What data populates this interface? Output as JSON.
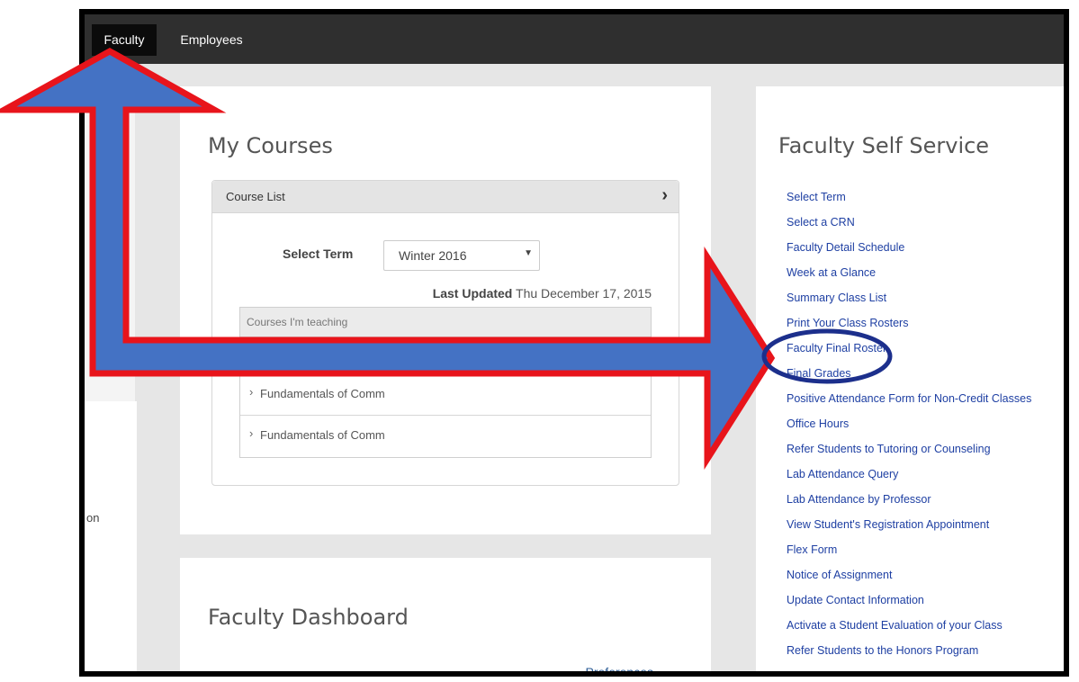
{
  "topnav": {
    "tabs": [
      {
        "label": "Faculty",
        "active": true
      },
      {
        "label": "Employees",
        "active": false
      }
    ]
  },
  "left_partial_text": "on",
  "my_courses": {
    "title": "My Courses",
    "course_list": {
      "header": "Course List",
      "chevron_icon": "chevron-right-icon",
      "select_term_label": "Select Term",
      "selected_term": "Winter 2016",
      "last_updated_label": "Last Updated",
      "last_updated_value": "Thu December 17, 2015",
      "teaching_header": "Courses I'm teaching",
      "courses": [
        {
          "name": "Fundamentals of Comm"
        },
        {
          "name": "Fundamentals of Comm"
        }
      ]
    }
  },
  "faculty_dashboard": {
    "title": "Faculty Dashboard",
    "preferences_link": "Preferences"
  },
  "faculty_self_service": {
    "title": "Faculty Self Service",
    "links": [
      "Select Term",
      "Select a CRN",
      "Faculty Detail Schedule",
      "Week at a Glance",
      "Summary Class List",
      "Print Your Class Rosters",
      "Faculty Final Roster",
      "Final Grades",
      "Positive Attendance Form for Non-Credit Classes",
      "Office Hours",
      "Refer Students to Tutoring or Counseling",
      "Lab Attendance Query",
      "Lab Attendance by Professor",
      "View Student's Registration Appointment",
      "Flex Form",
      "Notice of Assignment",
      "Update Contact Information",
      "Activate a Student Evaluation of your Class",
      "Refer Students to the Honors Program"
    ]
  },
  "annotation_colors": {
    "arrow_fill": "#4472c4",
    "arrow_outline": "#e8141b",
    "highlight_ellipse": "#1c2f8c"
  }
}
